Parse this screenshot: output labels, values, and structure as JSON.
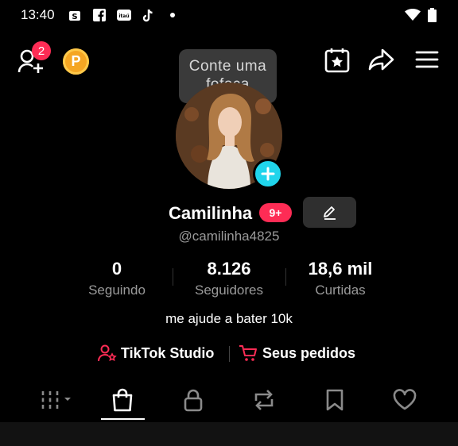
{
  "status_bar": {
    "time": "13:40",
    "icons": [
      "shopee-icon",
      "facebook-icon",
      "itau-icon",
      "tiktok-icon",
      "notification-dot",
      "wifi-icon",
      "battery-icon"
    ],
    "itau_label": "itaú"
  },
  "top_bar": {
    "add_friend_badge": "2",
    "coin_label": "P",
    "tooltip": "Conte uma fofoca"
  },
  "profile": {
    "name": "Camilinha",
    "name_badge": "9+",
    "handle": "@camilinha4825",
    "bio": "me ajude a bater 10k"
  },
  "stats": [
    {
      "value": "0",
      "label": "Seguindo"
    },
    {
      "value": "8.126",
      "label": "Seguidores"
    },
    {
      "value": "18,6 mil",
      "label": "Curtidas"
    }
  ],
  "links": {
    "studio": "TikTok Studio",
    "orders": "Seus pedidos"
  },
  "tabs": [
    "videos-grid-icon",
    "shop-bag-icon",
    "lock-icon",
    "repost-icon",
    "bookmark-icon",
    "heart-icon"
  ],
  "colors": {
    "accent": "#fe2c55",
    "cyan": "#20d5ec",
    "coin": "#f5a623"
  }
}
